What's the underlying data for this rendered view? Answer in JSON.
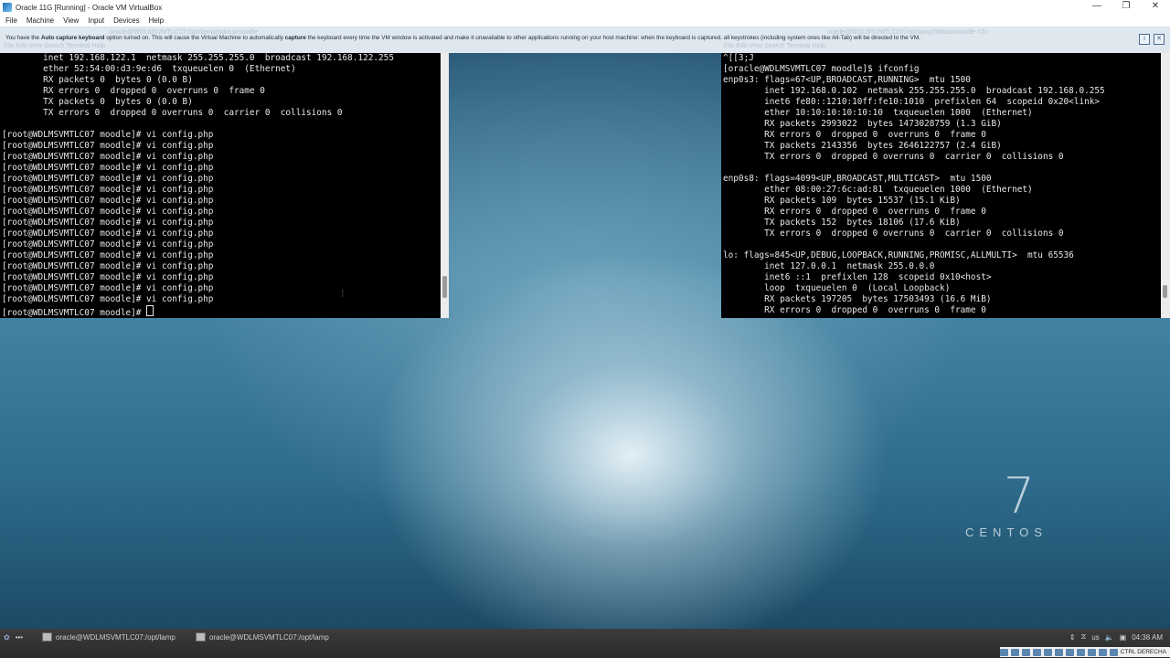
{
  "host": {
    "title": "Oracle 11G [Running] - Oracle VM VirtualBox",
    "menu": [
      "File",
      "Machine",
      "View",
      "Input",
      "Devices",
      "Help"
    ],
    "window_controls": [
      "—",
      "❐",
      "✕"
    ]
  },
  "infobar": {
    "message_part1": "You have the ",
    "bold1": "Auto capture keyboard",
    "message_part2": " option turned on. This will cause the Virtual Machine to automatically ",
    "bold2": "capture",
    "message_part3": " the keyboard every time the VM window is activated and make it unavailable to other applications running on your host machine: when the keyboard is captured, all keystrokes (including system ones like Alt-Tab) will be directed to the VM.",
    "ghost_title_left": "oracle@WDLMSVMTLC07:/opt/lamp/htdocs/moodle",
    "ghost_menu": "File  Edit  View  Search  Terminal  Help",
    "ghost_title_right": "oracle@WDLMSVMTLC07:/opt/lamp/htdocs/moodle <2>"
  },
  "left_terminal": {
    "lines": [
      "        inet 192.168.122.1  netmask 255.255.255.0  broadcast 192.168.122.255",
      "        ether 52:54:00:d3:9e:d6  txqueuelen 0  (Ethernet)",
      "        RX packets 0  bytes 0 (0.0 B)",
      "        RX errors 0  dropped 0  overruns 0  frame 0",
      "        TX packets 0  bytes 0 (0.0 B)",
      "        TX errors 0  dropped 0 overruns 0  carrier 0  collisions 0",
      "",
      "[root@WDLMSVMTLC07 moodle]# vi config.php",
      "[root@WDLMSVMTLC07 moodle]# vi config.php",
      "[root@WDLMSVMTLC07 moodle]# vi config.php",
      "[root@WDLMSVMTLC07 moodle]# vi config.php",
      "[root@WDLMSVMTLC07 moodle]# vi config.php",
      "[root@WDLMSVMTLC07 moodle]# vi config.php",
      "[root@WDLMSVMTLC07 moodle]# vi config.php",
      "[root@WDLMSVMTLC07 moodle]# vi config.php",
      "[root@WDLMSVMTLC07 moodle]# vi config.php",
      "[root@WDLMSVMTLC07 moodle]# vi config.php",
      "[root@WDLMSVMTLC07 moodle]# vi config.php",
      "[root@WDLMSVMTLC07 moodle]# vi config.php",
      "[root@WDLMSVMTLC07 moodle]# vi config.php",
      "[root@WDLMSVMTLC07 moodle]# vi config.php",
      "[root@WDLMSVMTLC07 moodle]# vi config.php",
      "[root@WDLMSVMTLC07 moodle]# vi config.php"
    ],
    "prompt": "[root@WDLMSVMTLC07 moodle]# "
  },
  "right_terminal": {
    "lines": [
      "^[[3;J",
      "[oracle@WDLMSVMTLC07 moodle]$ ifconfig",
      "enp0s3: flags=67<UP,BROADCAST,RUNNING>  mtu 1500",
      "        inet 192.168.0.102  netmask 255.255.255.0  broadcast 192.168.0.255",
      "        inet6 fe80::1210:10ff:fe10:1010  prefixlen 64  scopeid 0x20<link>",
      "        ether 10:10:10:10:10:10  txqueuelen 1000  (Ethernet)",
      "        RX packets 2993022  bytes 1473028759 (1.3 GiB)",
      "        RX errors 0  dropped 0  overruns 0  frame 0",
      "        TX packets 2143356  bytes 2646122757 (2.4 GiB)",
      "        TX errors 0  dropped 0 overruns 0  carrier 0  collisions 0",
      "",
      "enp0s8: flags=4099<UP,BROADCAST,MULTICAST>  mtu 1500",
      "        ether 08:00:27:6c:ad:81  txqueuelen 1000  (Ethernet)",
      "        RX packets 109  bytes 15537 (15.1 KiB)",
      "        RX errors 0  dropped 0  overruns 0  frame 0",
      "        TX packets 152  bytes 18106 (17.6 KiB)",
      "        TX errors 0  dropped 0 overruns 0  carrier 0  collisions 0",
      "",
      "lo: flags=845<UP,DEBUG,LOOPBACK,RUNNING,PROMISC,ALLMULTI>  mtu 65536",
      "        inet 127.0.0.1  netmask 255.0.0.0",
      "        inet6 ::1  prefixlen 128  scopeid 0x10<host>",
      "        loop  txqueuelen 0  (Local Loopback)",
      "        RX packets 197205  bytes 17503493 (16.6 MiB)",
      "        RX errors 0  dropped 0  overruns 0  frame 0"
    ]
  },
  "desktop": {
    "logo_number": "7",
    "logo_text": "CENTOS"
  },
  "taskbar": {
    "tasks": [
      "oracle@WDLMSVMTLC07:/opt/lamp",
      "oracle@WDLMSVMTLC07:/opt/lamp"
    ],
    "keyboard_layout": "us",
    "clock": "04:38 AM",
    "host_key": "CTRL DERECHA"
  }
}
